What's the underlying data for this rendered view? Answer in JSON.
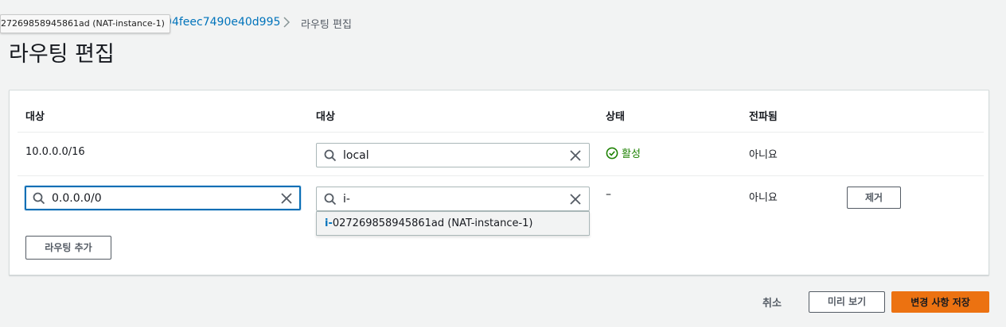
{
  "breadcrumb": {
    "tooltip": "27269858945861ad (NAT-instance-1)",
    "route_table_link": "-04feec7490e40d995",
    "current": "라우팅 편집"
  },
  "page_title": "라우팅 편집",
  "table": {
    "headers": [
      "대상",
      "대상",
      "상태",
      "전파됨"
    ],
    "rows": [
      {
        "destination": "10.0.0.0/16",
        "target": "local",
        "status": "활성",
        "propagated": "아니요"
      },
      {
        "destination": "0.0.0.0/0",
        "target": "i-",
        "status": "–",
        "propagated": "아니요",
        "remove_label": "제거"
      }
    ],
    "dropdown": {
      "match_prefix": "i-",
      "option_rest": "027269858945861ad (NAT-instance-1)"
    },
    "add_route_label": "라우팅 추가"
  },
  "footer": {
    "cancel_label": "취소",
    "preview_label": "미리 보기",
    "save_label": "변경 사항 저장"
  },
  "colors": {
    "link": "#0073bb",
    "success": "#1d8102",
    "primary": "#ec7211",
    "focus": "#0a6fb5"
  },
  "icons": [
    "search-icon",
    "clear-icon",
    "check-circle-icon",
    "chevron-right-icon"
  ]
}
